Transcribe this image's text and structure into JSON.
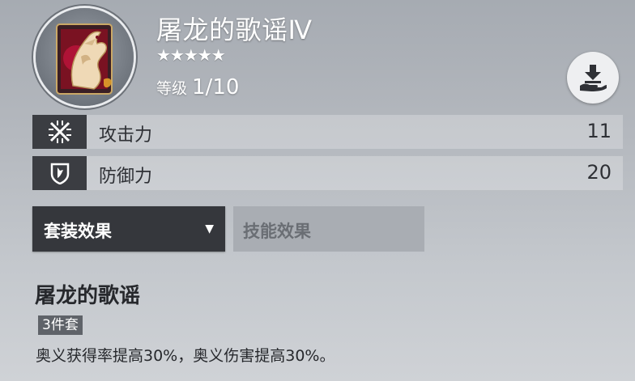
{
  "equipment": {
    "name": "屠龙的歌谣Ⅳ",
    "stars": "★★★★★",
    "level_label": "等级",
    "level_value": "1/10",
    "icon": "dragon-emblem"
  },
  "stats": [
    {
      "icon": "attack-icon",
      "label": "攻击力",
      "value": "11"
    },
    {
      "icon": "defense-shield-icon",
      "label": "防御力",
      "value": "20"
    }
  ],
  "tabs": {
    "active": {
      "label": "套装效果",
      "caret": "▼"
    },
    "inactive": {
      "label": "技能效果"
    }
  },
  "set_effect": {
    "name": "屠龙的歌谣",
    "badge": "3件套",
    "description": "奥义获得率提高30%，奥义伤害提高30%。"
  },
  "actions": {
    "icon": "download-to-hand-icon"
  },
  "colors": {
    "dark_panel": "#35373c",
    "stat_icon_bg": "#3b3d42",
    "text_dark": "#26282c",
    "text_light": "#ffffff"
  }
}
